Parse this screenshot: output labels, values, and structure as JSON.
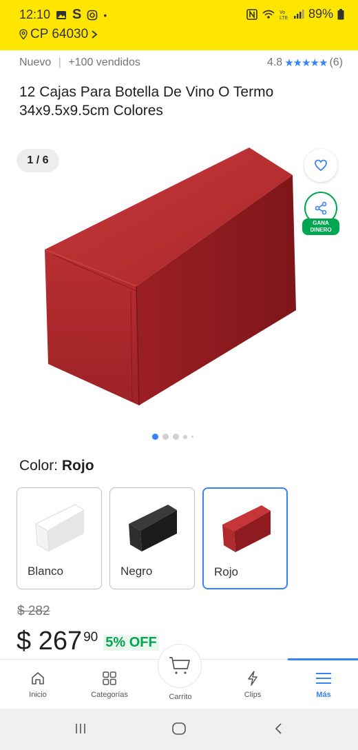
{
  "status_bar": {
    "time": "12:10",
    "battery": "89%"
  },
  "location": {
    "postal": "CP 64030"
  },
  "product": {
    "condition": "Nuevo",
    "sold": "+100 vendidos",
    "rating": "4.8",
    "rating_value": 4.8,
    "reviews": "(6)",
    "title": "12 Cajas Para Botella De Vino O Termo 34x9.5x9.5cm Colores"
  },
  "gallery": {
    "counter": "1 / 6",
    "share_badge_line1": "GANA",
    "share_badge_line2": "DINERO",
    "current_image": 1,
    "total_images": 6
  },
  "color": {
    "label": "Color:",
    "selected": "Rojo",
    "options": [
      {
        "name": "Blanco",
        "hex": "#f2f2f2"
      },
      {
        "name": "Negro",
        "hex": "#2a2a2a"
      },
      {
        "name": "Rojo",
        "hex": "#b82a2e"
      }
    ]
  },
  "price": {
    "original": "$ 282",
    "current_integer": "$ 267",
    "current_cents": "90",
    "discount": "5% OFF"
  },
  "bottom_nav": {
    "items": [
      {
        "label": "Inicio",
        "icon": "home-icon"
      },
      {
        "label": "Categorías",
        "icon": "grid-icon"
      },
      {
        "label": "Carrito",
        "icon": "cart-icon"
      },
      {
        "label": "Clips",
        "icon": "lightning-icon"
      },
      {
        "label": "Más",
        "icon": "menu-icon",
        "active": true
      }
    ]
  },
  "colors": {
    "brand_yellow": "#FFE600",
    "accent_blue": "#3483FA",
    "discount_green": "#00A650"
  }
}
